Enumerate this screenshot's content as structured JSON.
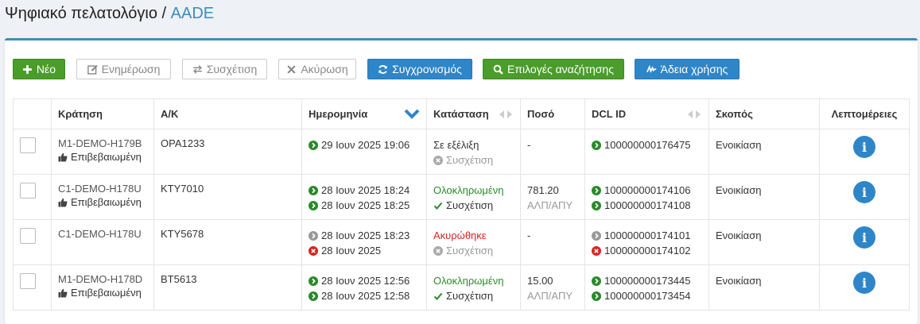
{
  "header": {
    "title": "Ψηφιακό πελατολόγιο /",
    "crumb": "AADE"
  },
  "toolbar": {
    "new": "Νέο",
    "update": "Ενημέρωση",
    "link": "Συσχέτιση",
    "cancel": "Ακύρωση",
    "sync": "Συγχρονισμός",
    "search_options": "Επιλογές αναζήτησης",
    "license": "Άδεια χρήσης"
  },
  "table": {
    "headers": {
      "booking": "Κράτηση",
      "plate": "Α/Κ",
      "date": "Ημερομηνία",
      "status": "Κατάσταση",
      "amount": "Ποσό",
      "dcl": "DCL ID",
      "purpose": "Σκοπός",
      "details": "Λεπτομέρειες"
    },
    "rows": [
      {
        "booking": "M1-DEMO-H179B",
        "confirm": "Επιβεβαιωμένη",
        "plate": "ΟΡΑ1233",
        "date1": "29 Ιουν 2025 19:06",
        "date2": "",
        "status": "Σε εξέλιξη",
        "link": "Συσχέτιση",
        "amount": "-",
        "amount_sub": "",
        "dcl1": "100000000176475",
        "dcl2": "",
        "purpose": "Ενοικίαση"
      },
      {
        "booking": "C1-DEMO-H178U",
        "confirm": "Επιβεβαιωμένη",
        "plate": "ΚΤΥ7010",
        "date1": "28 Ιουν 2025 18:24",
        "date2": "28 Ιουν 2025 18:25",
        "status": "Ολοκληρωμένη",
        "link": "Συσχέτιση",
        "amount": "781.20",
        "amount_sub": "ΑΛΠ/ΑΠΥ",
        "dcl1": "100000000174106",
        "dcl2": "100000000174108",
        "purpose": "Ενοικίαση"
      },
      {
        "booking": "C1-DEMO-H178U",
        "confirm": "",
        "plate": "ΚΤΥ5678",
        "date1": "28 Ιουν 2025 18:23",
        "date2": "28 Ιουν 2025",
        "status": "Ακυρώθηκε",
        "link": "Συσχέτιση",
        "amount": "-",
        "amount_sub": "",
        "dcl1": "100000000174101",
        "dcl2": "100000000174102",
        "purpose": "Ενοικίαση"
      },
      {
        "booking": "M1-DEMO-H178D",
        "confirm": "Επιβεβαιωμένη",
        "plate": "ΒΤ5613",
        "date1": "28 Ιουν 2025 12:56",
        "date2": "28 Ιουν 2025 12:58",
        "status": "Ολοκληρωμένη",
        "link": "Συσχέτιση",
        "amount": "15.00",
        "amount_sub": "ΑΛΠ/ΑΠΥ",
        "dcl1": "100000000173445",
        "dcl2": "100000000173454",
        "purpose": "Ενοικίαση"
      }
    ]
  },
  "colors": {
    "primary": "#2e86c9",
    "success": "#4a9d2a",
    "danger": "#d9241f",
    "muted": "#999999"
  }
}
